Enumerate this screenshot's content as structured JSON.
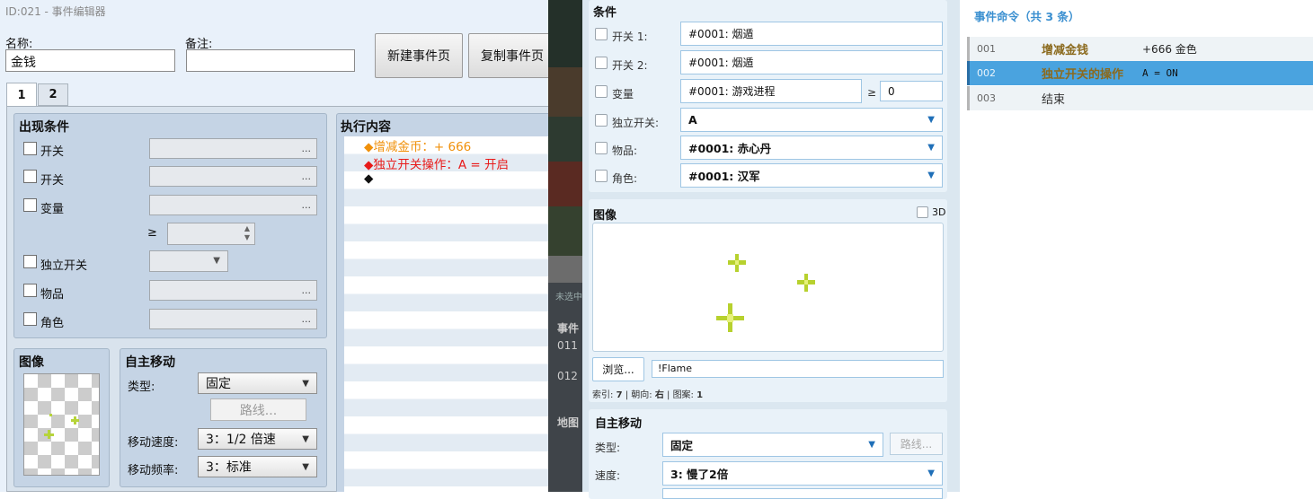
{
  "editor": {
    "title": "ID:021 - 事件编辑器",
    "name_label": "名称:",
    "name_value": "金钱",
    "note_label": "备注:",
    "note_value": "",
    "new_page_btn": "新建事件页",
    "copy_page_btn": "复制事件页",
    "tabs": [
      "1",
      "2"
    ],
    "conditions": {
      "title": "出现条件",
      "rows": [
        "开关",
        "开关",
        "变量",
        "独立开关",
        "物品",
        "角色"
      ],
      "ellipsis": "...",
      "ge": "≥"
    },
    "image": {
      "title": "图像"
    },
    "autonomous": {
      "title": "自主移动",
      "type_label": "类型:",
      "type_value": "固定",
      "route_btn": "路线...",
      "speed_label": "移动速度:",
      "speed_value": "3：1/2 倍速",
      "freq_label": "移动频率:",
      "freq_value": "3：标准"
    },
    "exec": {
      "title": "执行内容",
      "lines": [
        {
          "text": "◆增减金币：+ 666",
          "color": "#f0900a"
        },
        {
          "text": "◆独立开关操作：A = 开启",
          "color": "#e81a1a"
        },
        {
          "text": "◆",
          "color": "#000000"
        }
      ]
    }
  },
  "game_strip": {
    "labels": [
      "未选中",
      "事件",
      "011",
      "012",
      "地图"
    ]
  },
  "mid": {
    "conditions_title": "条件",
    "rows": [
      {
        "label": "开关 1:",
        "value": "#0001: 烟遁"
      },
      {
        "label": "开关 2:",
        "value": "#0001: 烟遁"
      },
      {
        "label": "变量",
        "value": "#0001: 游戏进程",
        "ge": "≥",
        "ge_value": "0"
      },
      {
        "label": "独立开关:",
        "value": "A"
      },
      {
        "label": "物品:",
        "value": "#0001: 赤心丹"
      },
      {
        "label": "角色:",
        "value": "#0001: 汉军"
      }
    ],
    "image_title": "图像",
    "three_d": "3D",
    "browse_btn": "浏览...",
    "image_file": "!Flame",
    "image_info": {
      "index_label": "索引:",
      "index": "7",
      "dir_label": "朝向:",
      "dir": "右",
      "pattern_label": "图案:",
      "pattern": "1"
    },
    "move_title": "自主移动",
    "type_label": "类型:",
    "type_value": "固定",
    "route_btn": "路线...",
    "speed_label": "速度:",
    "speed_value": "3: 慢了2倍"
  },
  "right": {
    "title": "事件命令（共 3 条）",
    "rows": [
      {
        "num": "001",
        "name": "增减金钱",
        "detail": "+666 金色",
        "selected": false
      },
      {
        "num": "002",
        "name": "独立开关的操作",
        "detail": "A = ON",
        "selected": true
      },
      {
        "num": "003",
        "name": "结束",
        "detail": "",
        "selected": false
      }
    ]
  },
  "colors": {
    "accent": "#4aa3df",
    "command_name": "#8b6a1e",
    "exec_gold": "#f0900a",
    "exec_red": "#e81a1a"
  }
}
